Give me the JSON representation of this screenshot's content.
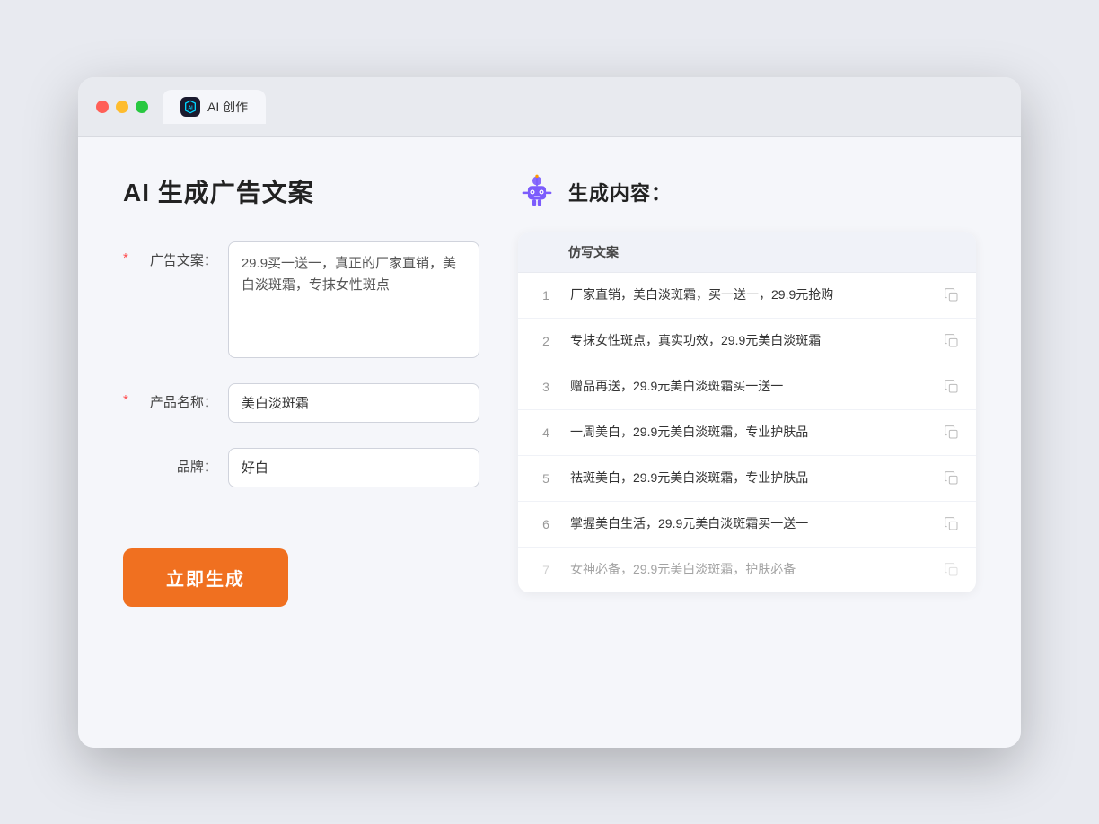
{
  "browser": {
    "tab_label": "AI 创作",
    "tab_icon_text": "AI"
  },
  "left_panel": {
    "page_title": "AI 生成广告文案",
    "form": {
      "ad_copy_label": "广告文案：",
      "ad_copy_required": "*",
      "ad_copy_value": "29.9买一送一，真正的厂家直销，美白淡斑霜，专抹女性斑点",
      "product_name_label": "产品名称：",
      "product_name_required": "*",
      "product_name_value": "美白淡斑霜",
      "brand_label": "品牌：",
      "brand_value": "好白"
    },
    "generate_button_label": "立即生成"
  },
  "right_panel": {
    "result_title": "生成内容：",
    "table_header": "仿写文案",
    "results": [
      {
        "number": "1",
        "text": "厂家直销，美白淡斑霜，买一送一，29.9元抢购",
        "dimmed": false
      },
      {
        "number": "2",
        "text": "专抹女性斑点，真实功效，29.9元美白淡斑霜",
        "dimmed": false
      },
      {
        "number": "3",
        "text": "赠品再送，29.9元美白淡斑霜买一送一",
        "dimmed": false
      },
      {
        "number": "4",
        "text": "一周美白，29.9元美白淡斑霜，专业护肤品",
        "dimmed": false
      },
      {
        "number": "5",
        "text": "祛斑美白，29.9元美白淡斑霜，专业护肤品",
        "dimmed": false
      },
      {
        "number": "6",
        "text": "掌握美白生活，29.9元美白淡斑霜买一送一",
        "dimmed": false
      },
      {
        "number": "7",
        "text": "女神必备，29.9元美白淡斑霜，护肤必备",
        "dimmed": true
      }
    ]
  },
  "colors": {
    "orange_btn": "#f07020",
    "required_red": "#ff4d4f",
    "accent_blue": "#4a90e2"
  }
}
